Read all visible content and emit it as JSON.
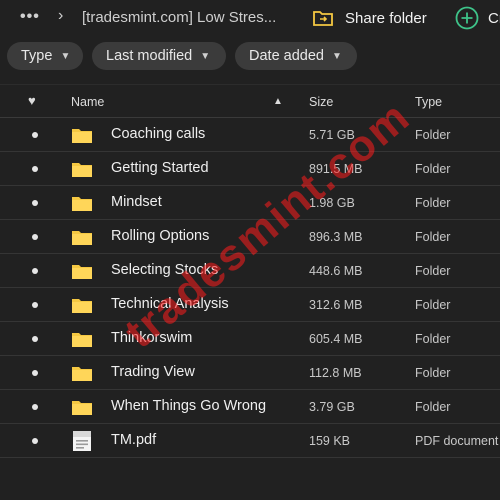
{
  "topbar": {
    "more": "•••",
    "chevron": "›",
    "breadcrumb": "[tradesmint.com] Low Stres...",
    "share_label": "Share folder",
    "create_label": "Cr"
  },
  "filters": [
    {
      "label": "Type"
    },
    {
      "label": "Last modified"
    },
    {
      "label": "Date added"
    }
  ],
  "columns": {
    "favorite": "♥",
    "name": "Name",
    "sort": "▲",
    "size": "Size",
    "type": "Type"
  },
  "rows": [
    {
      "name": "Coaching calls",
      "size": "5.71 GB",
      "type": "Folder",
      "icon": "folder-icon"
    },
    {
      "name": "Getting Started",
      "size": "891.5 MB",
      "type": "Folder",
      "icon": "folder-icon"
    },
    {
      "name": "Mindset",
      "size": "1.98 GB",
      "type": "Folder",
      "icon": "folder-icon"
    },
    {
      "name": "Rolling Options",
      "size": "896.3 MB",
      "type": "Folder",
      "icon": "folder-icon"
    },
    {
      "name": "Selecting Stocks",
      "size": "448.6 MB",
      "type": "Folder",
      "icon": "folder-icon"
    },
    {
      "name": "Technical Analysis",
      "size": "312.6 MB",
      "type": "Folder",
      "icon": "folder-icon"
    },
    {
      "name": "Thinkorswim",
      "size": "605.4 MB",
      "type": "Folder",
      "icon": "folder-icon"
    },
    {
      "name": "Trading View",
      "size": "112.8 MB",
      "type": "Folder",
      "icon": "folder-icon"
    },
    {
      "name": "When Things Go Wrong",
      "size": "3.79 GB",
      "type": "Folder",
      "icon": "folder-icon"
    },
    {
      "name": "TM.pdf",
      "size": "159 KB",
      "type": "PDF document",
      "icon": "pdf-file-icon"
    }
  ],
  "watermark": "tradesmint.com",
  "colors": {
    "background": "#212121",
    "folder": "#f5c842",
    "accent_share": "#f5c842",
    "accent_create": "#3ec48a",
    "watermark": "#ff2a2a"
  }
}
